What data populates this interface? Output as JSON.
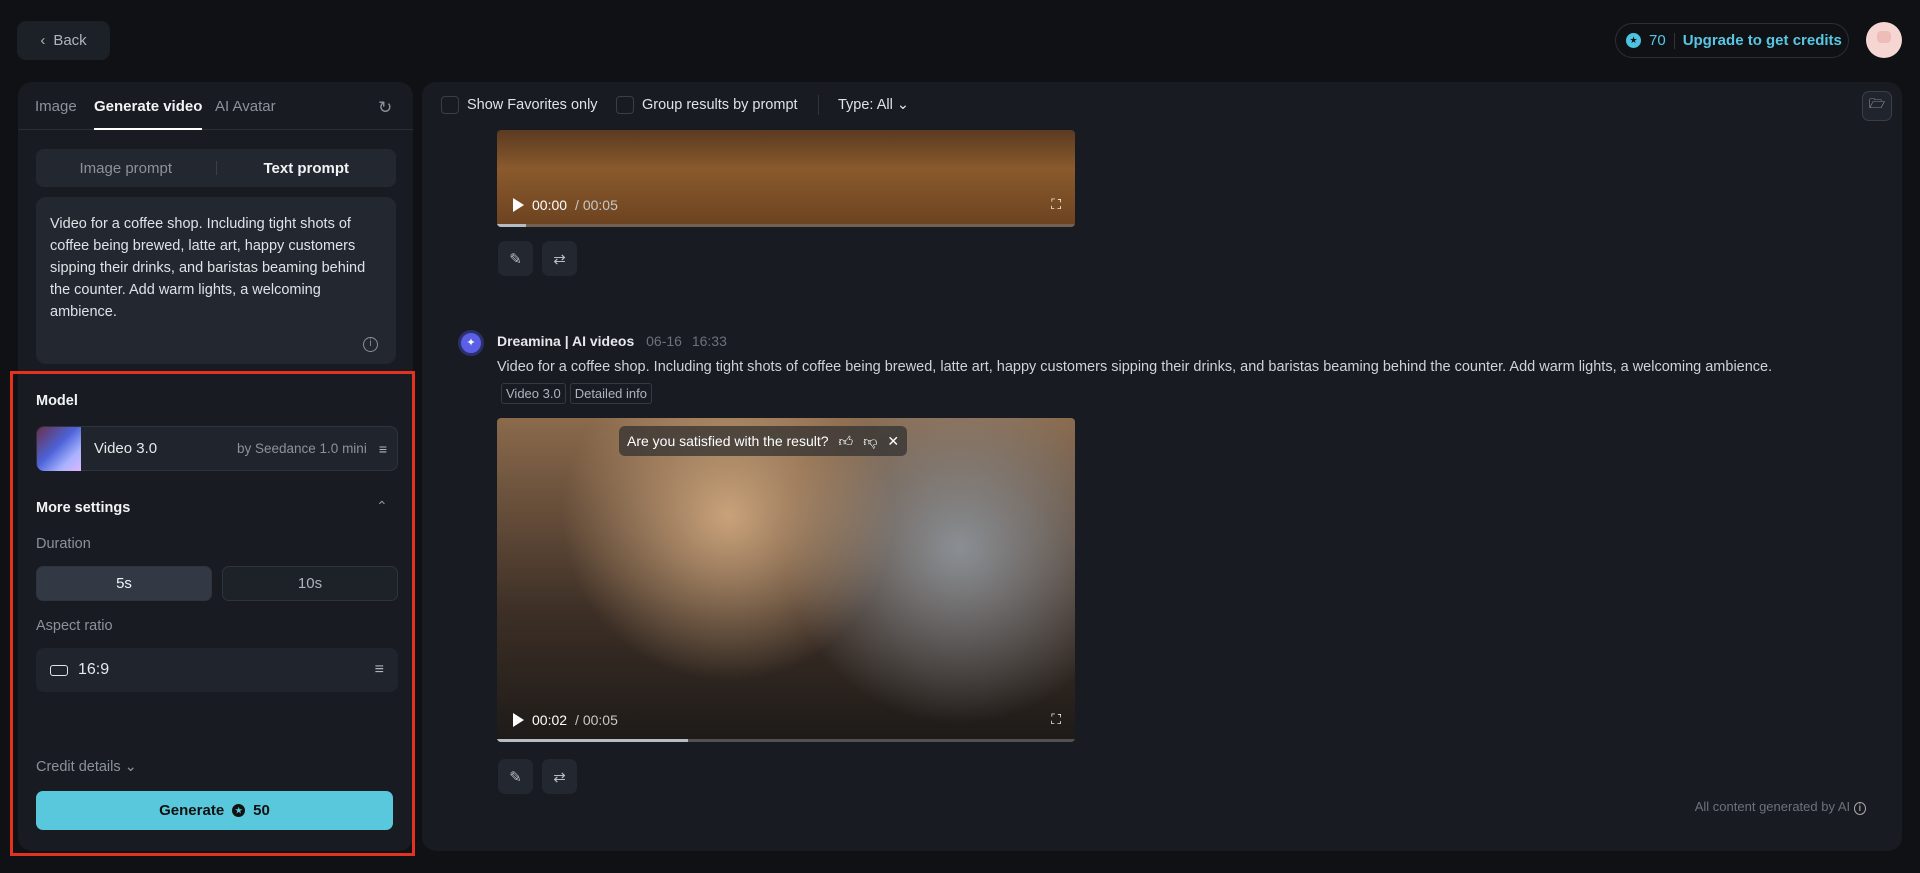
{
  "header": {
    "back_label": "Back",
    "credits": "70",
    "upgrade_label": "Upgrade to get credits"
  },
  "left": {
    "tabs": [
      "Image",
      "Generate video",
      "AI Avatar"
    ],
    "prompt_modes": [
      "Image prompt",
      "Text prompt"
    ],
    "prompt_text": "Video for a coffee shop. Including tight shots of coffee being brewed, latte art, happy customers sipping their  drinks, and baristas beaming behind the counter. Add warm lights, a welcoming ambience.",
    "model_label": "Model",
    "model_name": "Video 3.0",
    "model_by": "by Seedance 1.0 mini",
    "more_settings": "More settings",
    "duration_label": "Duration",
    "durations": [
      "5s",
      "10s"
    ],
    "aspect_label": "Aspect ratio",
    "aspect_value": "16:9",
    "credit_details": "Credit details",
    "generate_label": "Generate",
    "generate_cost": "50"
  },
  "toolbar": {
    "favorites": "Show Favorites only",
    "group": "Group results by prompt",
    "type": "Type: All"
  },
  "results": [
    {
      "current": "00:00",
      "total": "00:05",
      "progress": 0.05
    },
    {
      "author": "Dreamina | AI videos",
      "date": "06-16",
      "time": "16:33",
      "prompt": "Video for a coffee shop. Including tight shots of coffee being brewed, latte art, happy customers sipping their  drinks, and baristas beaming behind the counter. Add warm lights, a welcoming ambience.",
      "tags": [
        "Video 3.0",
        "Detailed info"
      ],
      "survey": "Are you satisfied with the result?",
      "current": "00:02",
      "total": "00:05",
      "progress": 0.33
    }
  ],
  "footer": "All content generated by AI",
  "colors": {
    "accent": "#59c8dc",
    "highlight": "#e5311f"
  }
}
